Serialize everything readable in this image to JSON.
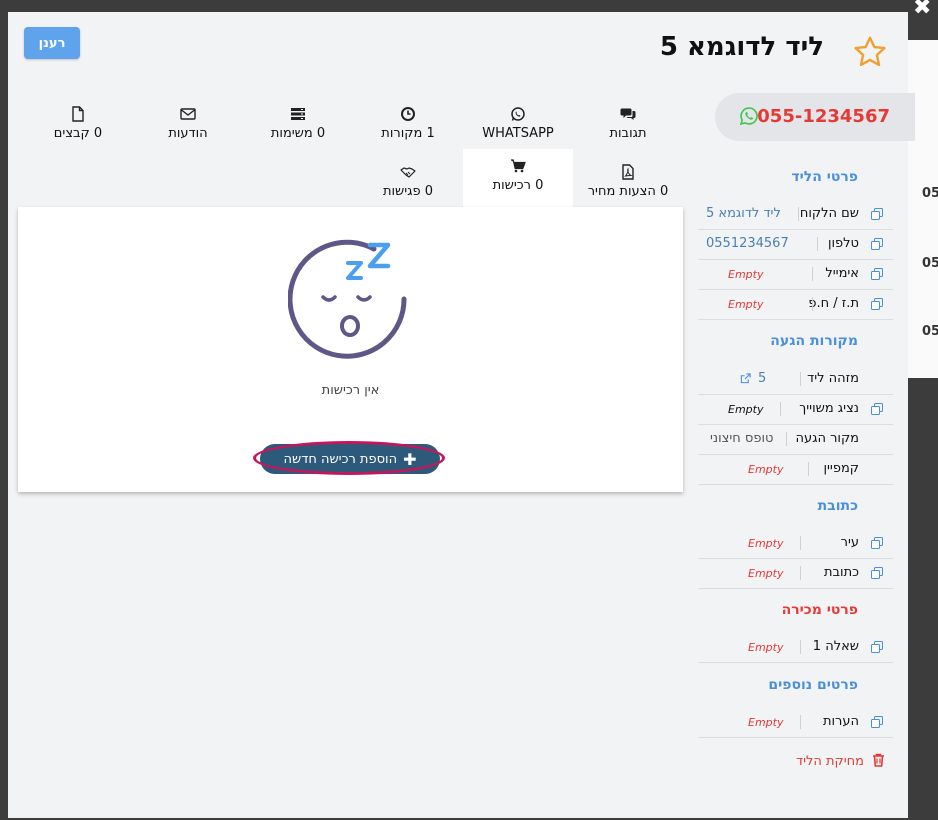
{
  "header": {
    "title": "ליד לדוגמא 5",
    "refresh_label": "רענן",
    "star_icon": "star-outline-icon",
    "close_icon": "close-icon"
  },
  "phone": {
    "number": "055-1234567",
    "icon": "whatsapp-icon"
  },
  "tabs": [
    {
      "label": "תגובות",
      "icon": "comments-icon"
    },
    {
      "label": "WHATSAPP",
      "icon": "whatsapp-icon"
    },
    {
      "label": "1 מקורות",
      "icon": "clock-icon"
    },
    {
      "label": "0 משימות",
      "icon": "tasks-icon"
    },
    {
      "label": "הודעות",
      "icon": "envelope-icon"
    },
    {
      "label": "0 קבצים",
      "icon": "file-icon"
    },
    {
      "label": "0 הצעות מחיר",
      "icon": "pdf-icon"
    },
    {
      "label": "0 רכישות",
      "icon": "cart-icon",
      "active": true
    },
    {
      "label": "0 פגישות",
      "icon": "handshake-icon"
    }
  ],
  "purchases": {
    "empty_text": "אין רכישות",
    "add_label": "הוספת רכישה חדשה",
    "illustration": "sleeping-face-icon"
  },
  "sections": {
    "lead": "פרטי הליד",
    "source": "מקורות הגעה",
    "address": "כתובת",
    "sale": "פרטי מכירה",
    "extra": "פרטים נוספים"
  },
  "fields": {
    "customer_name": {
      "label": "שם הלקוח",
      "value": "ליד לדוגמא 5"
    },
    "phone": {
      "label": "טלפון",
      "value": "0551234567"
    },
    "email": {
      "label": "אימייל",
      "value": "Empty"
    },
    "id": {
      "label": "ת.ז / ח.פ",
      "value": "Empty"
    },
    "lead_id": {
      "label": "מזהה ליד",
      "value": "5"
    },
    "rep": {
      "label": "נציג משוייך",
      "value": "Empty"
    },
    "source": {
      "label": "מקור הגעה",
      "value": "טופס חיצוני"
    },
    "campaign": {
      "label": "קמפיין",
      "value": "Empty"
    },
    "city": {
      "label": "עיר",
      "value": "Empty"
    },
    "address": {
      "label": "כתובת",
      "value": "Empty"
    },
    "q1": {
      "label": "שאלה 1",
      "value": "Empty"
    },
    "notes": {
      "label": "הערות",
      "value": "Empty"
    }
  },
  "delete_label": "מחיקת הליד",
  "background": {
    "edge_values": [
      "05",
      "05",
      "05"
    ]
  },
  "colors": {
    "accent": "#4a90d9",
    "danger": "#e53935",
    "primary_btn": "#2d5a7b",
    "refresh": "#5fa3ec"
  }
}
